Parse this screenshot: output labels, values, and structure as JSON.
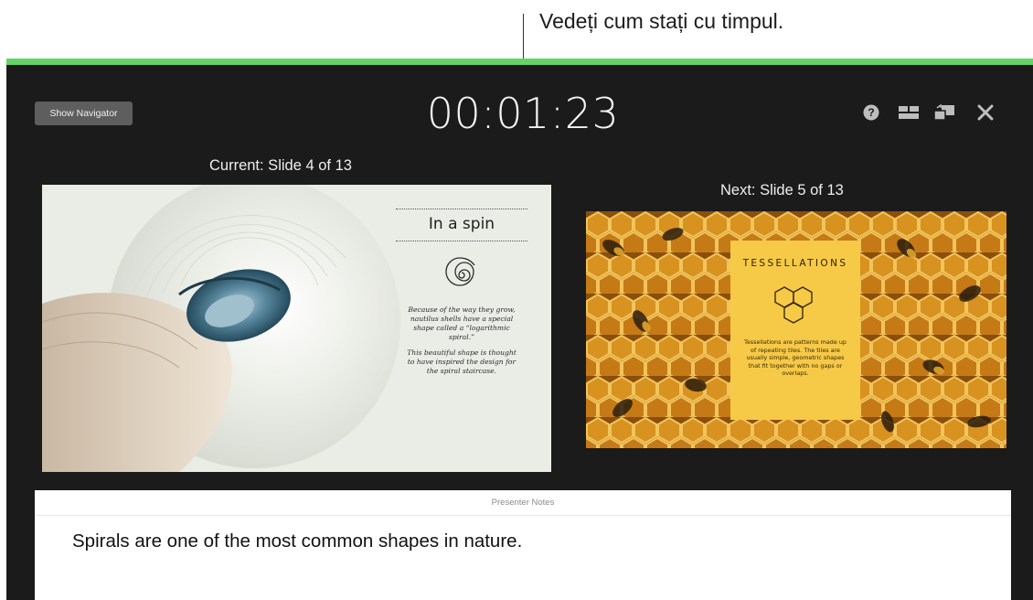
{
  "callout": {
    "text": "Vedeți cum stați cu timpul."
  },
  "presenter": {
    "navigator_button": "Show Navigator",
    "timer": "00:01:23",
    "controls": {
      "help_icon": "question-circle-icon",
      "layout_icon": "layout-icon",
      "swap_icon": "swap-displays-icon",
      "close_icon": "close-icon"
    },
    "current_label": "Current: Slide 4 of 13",
    "next_label": "Next: Slide 5 of 13"
  },
  "current_slide": {
    "title": "In a spin",
    "paragraph1": "Because of the way they grow, nautilus shells have a special shape called a “logarithmic spiral.”",
    "paragraph2": "This beautiful shape is thought to have inspired the design for the spiral staircase."
  },
  "next_slide": {
    "title": "TESSELLATIONS",
    "body": "Tessellations are patterns made up of repeating tiles. The tiles are usually simple, geometric shapes that fit together with no gaps or overlaps."
  },
  "notes": {
    "header": "Presenter Notes",
    "text": "Spirals are one of the most common shapes in nature."
  },
  "colors": {
    "accent_bar": "#64d468",
    "background": "#1b1b1b",
    "tessellation_card": "#f6c947"
  }
}
